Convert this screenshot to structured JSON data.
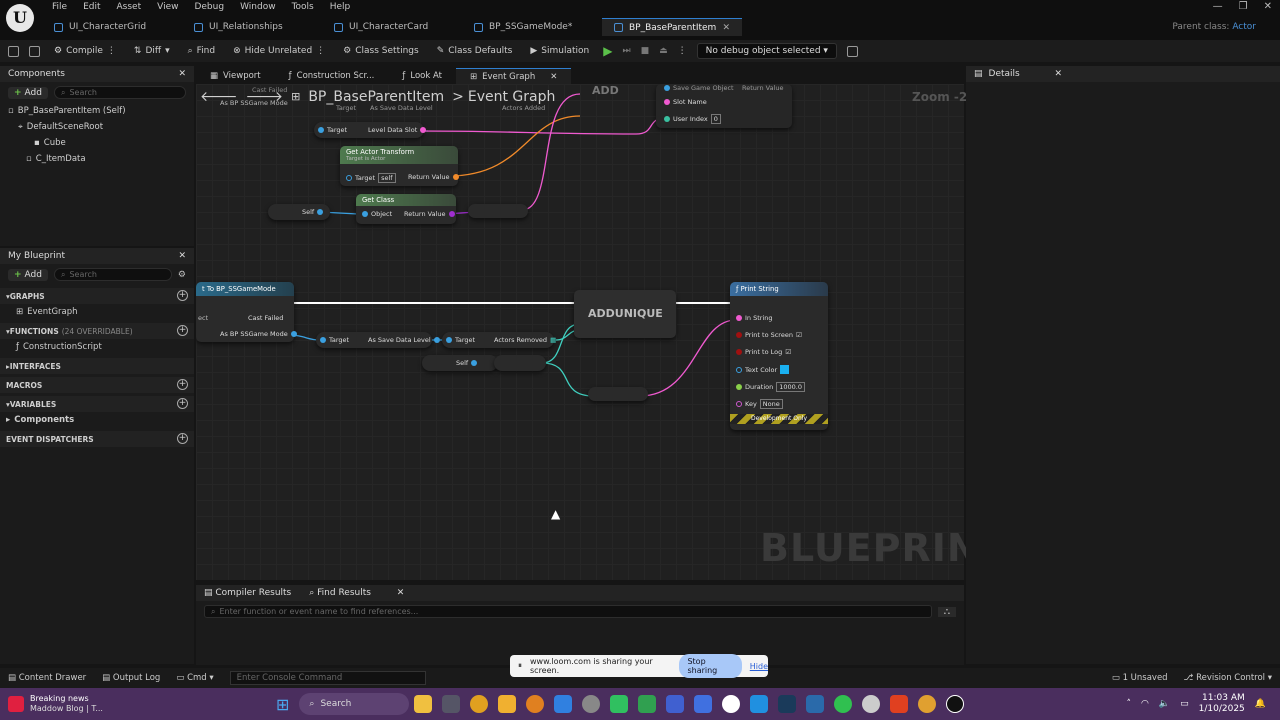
{
  "menu": [
    "File",
    "Edit",
    "Asset",
    "View",
    "Debug",
    "Window",
    "Tools",
    "Help"
  ],
  "tabs": [
    {
      "label": "UI_CharacterGrid",
      "active": false
    },
    {
      "label": "UI_Relationships",
      "active": false
    },
    {
      "label": "UI_CharacterCard",
      "active": false
    },
    {
      "label": "BP_SSGameMode*",
      "active": false
    },
    {
      "label": "BP_BaseParentItem",
      "active": true
    }
  ],
  "parent_class": {
    "label": "Parent class:",
    "value": "Actor"
  },
  "toolbar": {
    "compile": "Compile",
    "diff": "Diff",
    "find": "Find",
    "hide_unrelated": "Hide Unrelated",
    "class_settings": "Class Settings",
    "class_defaults": "Class Defaults",
    "simulation": "Simulation",
    "debug_object": "No debug object selected"
  },
  "components": {
    "title": "Components",
    "add": "Add",
    "search_placeholder": "Search",
    "items": [
      "BP_BaseParentItem (Self)",
      "DefaultSceneRoot",
      "Cube",
      "C_ItemData"
    ]
  },
  "my_blueprint": {
    "title": "My Blueprint",
    "add": "Add",
    "search_placeholder": "Search",
    "graphs": "GRAPHS",
    "event_graph": "EventGraph",
    "functions": "FUNCTIONS",
    "functions_count": "(24 OVERRIDABLE)",
    "construction": "ConstructionScript",
    "interfaces": "INTERFACES",
    "macros": "MACROS",
    "variables": "VARIABLES",
    "components": "Components",
    "event_dispatchers": "EVENT DISPATCHERS"
  },
  "graph_tabs": [
    {
      "label": "Viewport",
      "active": false
    },
    {
      "label": "Construction Scr...",
      "active": false
    },
    {
      "label": "Look At",
      "active": false
    },
    {
      "label": "Event Graph",
      "active": true
    }
  ],
  "breadcrumb": {
    "root": "BP_BaseParentItem",
    "sep": ">",
    "current": "Event Graph"
  },
  "zoom": "Zoom -2",
  "watermark": "BLUEPRINT",
  "details": {
    "title": "Details"
  },
  "nodes": {
    "cast_top": "Cast Failed",
    "cast_top_out": "As BP SSGame Mode",
    "target": "Target",
    "as_save_data": "As Save Data Level",
    "actors_added": "Actors Added",
    "level_data_slot": "Level Data Slot",
    "add": "ADD",
    "save_game_object": "Save Game Object",
    "return_value": "Return Value",
    "slot_name": "Slot Name",
    "user_index": "User Index",
    "user_index_val": "0",
    "get_actor_transform": "Get Actor Transform",
    "target_is_actor": "Target is Actor",
    "self_val": "self",
    "self": "Self",
    "get_class": "Get Class",
    "object": "Object",
    "cast_to": "t To BP_SSGameMode",
    "ect": "ect",
    "cast_failed": "Cast Failed",
    "as_bp_ssgame": "As BP SSGame Mode",
    "actors_removed": "Actors Removed",
    "adduniqe": "ADDUNIQUE",
    "print_string": "Print String",
    "in_string": "In String",
    "print_to_screen": "Print to Screen",
    "print_to_log": "Print to Log",
    "text_color": "Text Color",
    "duration": "Duration",
    "duration_val": "1000.0",
    "key": "Key",
    "key_val": "None",
    "dev_only": "Development Only"
  },
  "bottom": {
    "compiler_results": "Compiler Results",
    "find_results": "Find Results",
    "search_placeholder": "Enter function or event name to find references..."
  },
  "status": {
    "content_drawer": "Content Drawer",
    "output_log": "Output Log",
    "cmd": "Cmd",
    "console_placeholder": "Enter Console Command",
    "unsaved": "1 Unsaved",
    "revision": "Revision Control"
  },
  "loom": {
    "text": "www.loom.com is sharing your screen.",
    "stop": "Stop sharing",
    "hide": "Hide"
  },
  "taskbar": {
    "news_title": "Breaking news",
    "news_sub": "Maddow Blog | T...",
    "search": "Search",
    "time": "11:03 AM",
    "date": "1/10/2025"
  },
  "colors": {
    "accent": "#2f7fd0",
    "exec": "#ffffff",
    "object_pin": "#3aa0e0",
    "struct_pin": "#f08a2a",
    "class_pin": "#d02ed0",
    "string_pin": "#f05ad0",
    "bool_pin": "#a01010",
    "float_pin": "#8ad04a"
  }
}
